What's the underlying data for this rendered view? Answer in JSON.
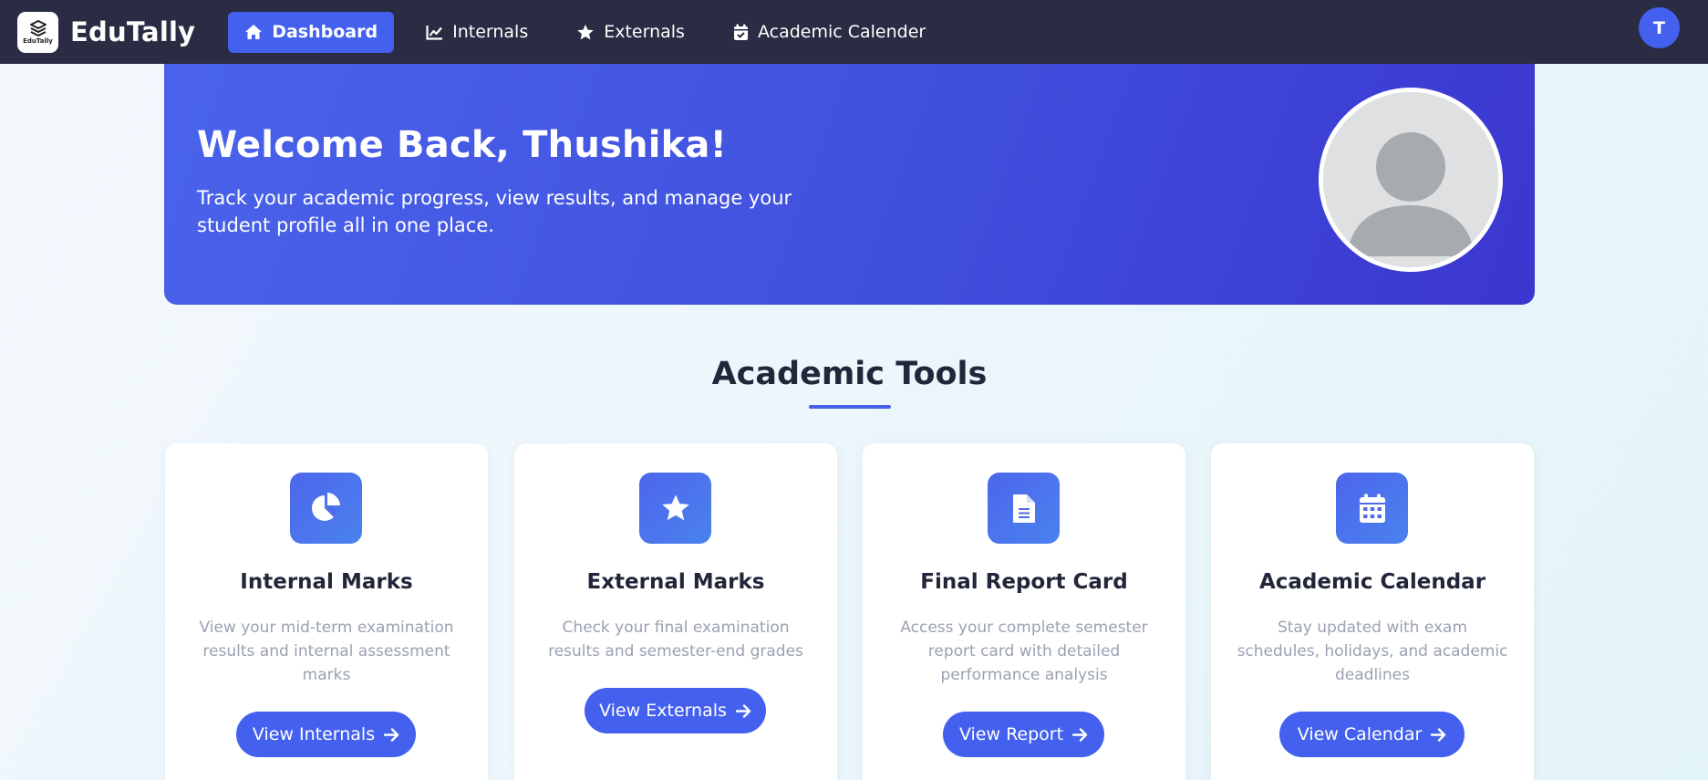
{
  "brand": {
    "name": "EduTally",
    "logo_text": "EduTally",
    "logo_icon": "layers-icon"
  },
  "nav": {
    "items": [
      {
        "label": "Dashboard",
        "icon": "home-icon",
        "active": true
      },
      {
        "label": "Internals",
        "icon": "line-chart-icon",
        "active": false
      },
      {
        "label": "Externals",
        "icon": "star-icon",
        "active": false
      },
      {
        "label": "Academic Calender",
        "icon": "calendar-check-icon",
        "active": false
      }
    ],
    "user_initial": "T"
  },
  "hero": {
    "title": "Welcome Back, Thushika!",
    "subtitle": "Track your academic progress, view results, and manage your student profile all in one place.",
    "avatar_icon": "user-placeholder-icon"
  },
  "section": {
    "title": "Academic Tools"
  },
  "cards": [
    {
      "icon": "pie-chart-icon",
      "title": "Internal Marks",
      "description": "View your mid-term examination results and internal assessment marks",
      "button": "View Internals"
    },
    {
      "icon": "star-icon",
      "title": "External Marks",
      "description": "Check your final examination results and semester-end grades",
      "button": "View Externals"
    },
    {
      "icon": "document-icon",
      "title": "Final Report Card",
      "description": "Access your complete semester report card with detailed performance analysis",
      "button": "View Report"
    },
    {
      "icon": "calendar-icon",
      "title": "Academic Calendar",
      "description": "Stay updated with exam schedules, holidays, and academic deadlines",
      "button": "View Calendar"
    }
  ],
  "colors": {
    "navbar": "#292c42",
    "accent": "#4361ee",
    "hero_start": "#4a63eb",
    "hero_end": "#3b36cf",
    "text_dark": "#22263a",
    "text_muted": "#9aa1b1"
  }
}
